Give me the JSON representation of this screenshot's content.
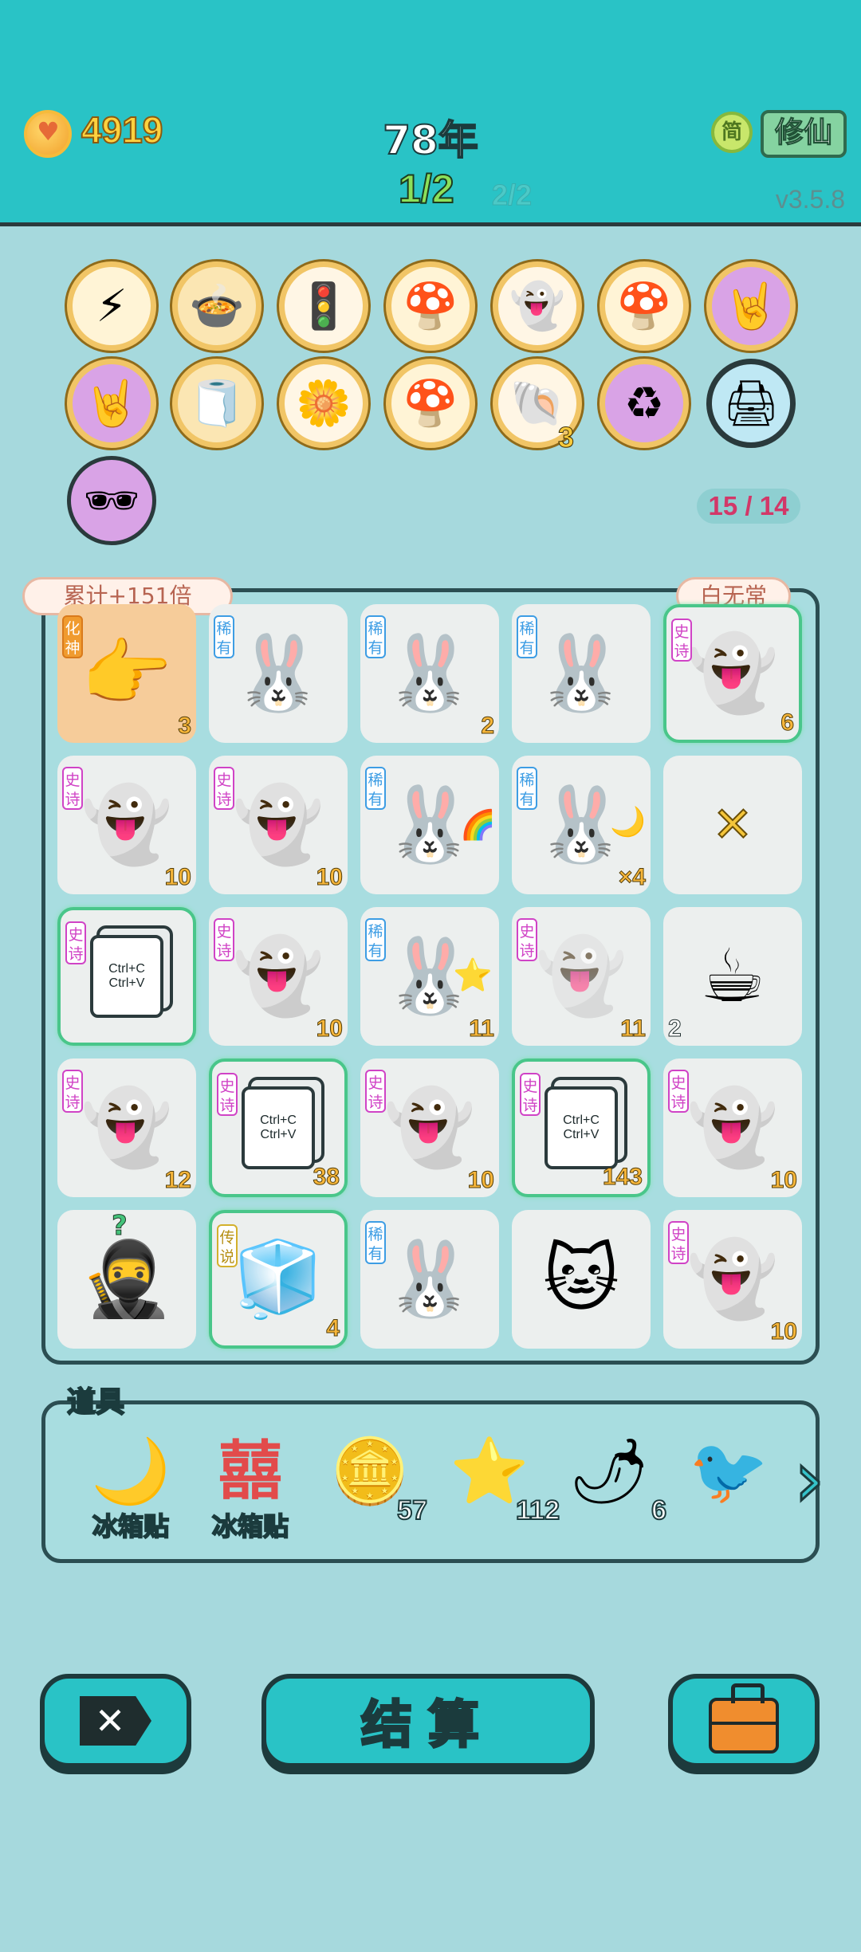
{
  "header": {
    "coins": "4919",
    "year": "78年",
    "page_current": "1/2",
    "page_other": "2/2",
    "version": "v3.5.8",
    "mode_simple": "简",
    "mode_cultivate": "修仙"
  },
  "relics": {
    "counter": "15 / 14",
    "badge_shell": "3",
    "items": [
      "lightning-icon",
      "rice-cooker-icon",
      "ghost-traffic-light-icon",
      "mushroom-cloud-icon",
      "winking-ghost-icon",
      "mushroom-cloud-icon",
      "rock-hand-icon",
      "rock-hand-icon",
      "tissue-box-icon",
      "flower-pot-icon",
      "mushroom-cloud-icon",
      "shell-icon",
      "recycle-icon",
      "printer-warning-icon",
      "sunglasses-peach-icon"
    ]
  },
  "board": {
    "multiplier": "累计+151倍",
    "boss": "白无常",
    "tags": {
      "rare": "稀有",
      "epic": "史诗",
      "legend": "传说",
      "form": "化神"
    },
    "cells": [
      {
        "icon": "pointing-hand-icon",
        "tag": "化神",
        "count": "3"
      },
      {
        "icon": "rabbit-icon",
        "tag": "稀有",
        "count": ""
      },
      {
        "icon": "rabbit-icon",
        "tag": "稀有",
        "count": "2"
      },
      {
        "icon": "rabbit-icon",
        "tag": "稀有",
        "count": ""
      },
      {
        "icon": "ghost-plus-icon",
        "tag": "史诗",
        "count": "6"
      },
      {
        "icon": "ghost-icon",
        "tag": "史诗",
        "count": "10"
      },
      {
        "icon": "ghost-icon",
        "tag": "史诗",
        "count": "10"
      },
      {
        "icon": "rabbit-rainbow-icon",
        "tag": "稀有",
        "count": ""
      },
      {
        "icon": "rabbit-moon-icon",
        "tag": "稀有",
        "count": "×4"
      },
      {
        "icon": "cross-icon",
        "tag": "",
        "count": ""
      },
      {
        "icon": "copy-card-icon",
        "tag": "史诗",
        "count": ""
      },
      {
        "icon": "ghost-icon",
        "tag": "史诗",
        "count": "10"
      },
      {
        "icon": "rabbit-star-icon",
        "tag": "稀有",
        "count": "11"
      },
      {
        "icon": "ghost-crossed-icon",
        "tag": "史诗",
        "count": "11"
      },
      {
        "icon": "coffee-icon",
        "tag": "",
        "count": "2"
      },
      {
        "icon": "ghost-icon",
        "tag": "史诗",
        "count": "12"
      },
      {
        "icon": "copy-card-icon",
        "tag": "史诗",
        "count": "38"
      },
      {
        "icon": "ghost-icon",
        "tag": "史诗",
        "count": "10"
      },
      {
        "icon": "copy-card-icon",
        "tag": "史诗",
        "count": "143"
      },
      {
        "icon": "ghost-icon",
        "tag": "史诗",
        "count": "10"
      },
      {
        "icon": "thief-icon",
        "tag": "",
        "count": ""
      },
      {
        "icon": "fridge-icon",
        "tag": "传说",
        "count": "4"
      },
      {
        "icon": "rabbit-icon",
        "tag": "稀有",
        "count": ""
      },
      {
        "icon": "cat-icon",
        "tag": "",
        "count": ""
      },
      {
        "icon": "ghost-icon",
        "tag": "史诗",
        "count": "10"
      }
    ],
    "copy_text_1": "Ctrl+C",
    "copy_text_2": "Ctrl+V"
  },
  "props": {
    "title": "道具",
    "items": [
      {
        "icon": "moon-icon",
        "label": "冰箱贴",
        "count": ""
      },
      {
        "icon": "double-happiness-icon",
        "label": "冰箱贴",
        "count": ""
      },
      {
        "icon": "dollar-coin-icon",
        "label": "",
        "count": "57"
      },
      {
        "icon": "star-icon",
        "label": "",
        "count": "112"
      },
      {
        "icon": "chili-icon",
        "label": "",
        "count": "6"
      },
      {
        "icon": "bird-icon",
        "label": "",
        "count": ""
      }
    ]
  },
  "buttons": {
    "clear": "delete-icon",
    "settle": "结算",
    "bag": "briefcase-icon"
  }
}
